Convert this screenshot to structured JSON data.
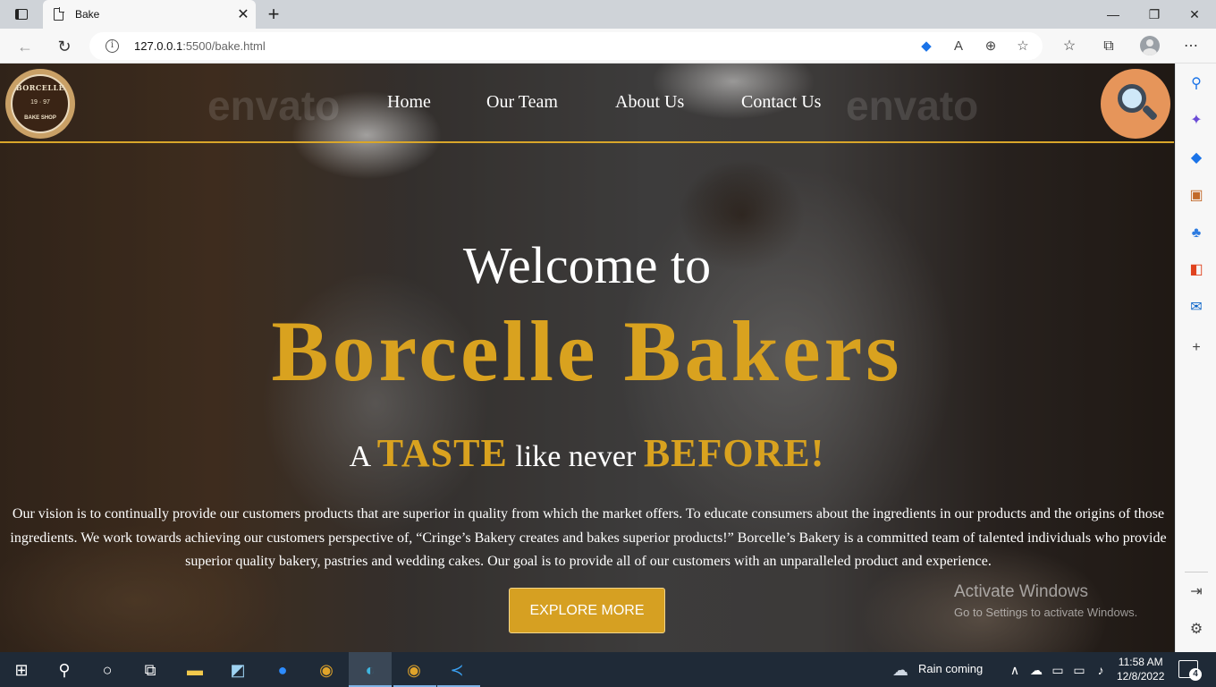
{
  "browser": {
    "tab_title": "Bake",
    "url_host": "127.0.0.1",
    "url_rest": ":5500/bake.html"
  },
  "page": {
    "logo": {
      "top": "BORCELLE",
      "mid": "19 · 97",
      "bottom": "BAKE SHOP"
    },
    "nav": [
      "Home",
      "Our Team",
      "About Us",
      "Contact Us"
    ],
    "watermark": "envato",
    "welcome": "Welcome to",
    "brand": "Borcelle Bakers",
    "tagline": {
      "a": "A",
      "taste": "TASTE",
      "like": "like never",
      "before": "BEFORE!"
    },
    "description": "Our vision is to continually provide our customers products that are superior in quality from which the market offers. To educate consumers about the ingredients in our products and the origins of those ingredients. We work towards achieving our customers perspective of, “Cringe’s Bakery creates and bakes superior products!” Borcelle’s Bakery is a committed team of talented individuals who provide superior quality bakery, pastries and wedding cakes. Our goal is to provide all of our customers with an unparalleled product and experience.",
    "cta": "EXPLORE MORE",
    "activation": {
      "title": "Activate Windows",
      "subtitle": "Go to Settings to activate Windows."
    }
  },
  "taskbar": {
    "weather": "Rain coming",
    "time": "11:58 AM",
    "date": "12/8/2022",
    "notifications": "4"
  },
  "colors": {
    "gold": "#d9a21f",
    "button": "#d6a022",
    "search_circle": "#e6955a",
    "taskbar": "#1f2a37"
  }
}
